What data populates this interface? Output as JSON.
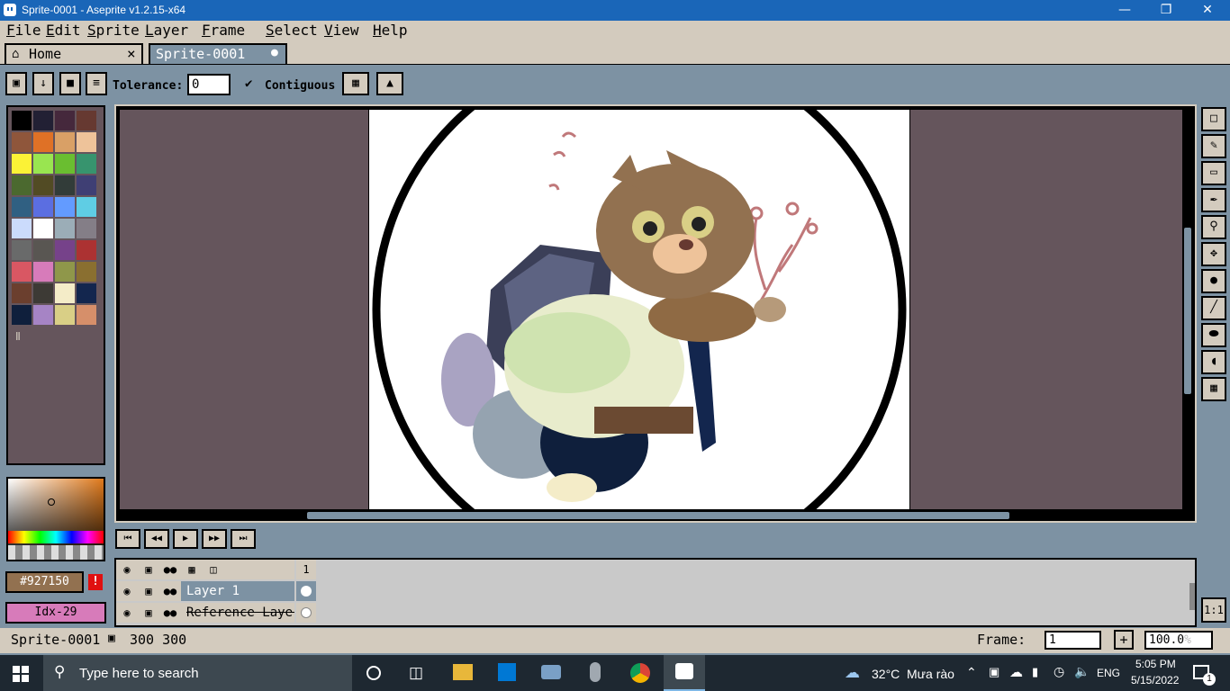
{
  "window": {
    "title": "Sprite-0001 - Aseprite v1.2.15-x64",
    "minimize": "—",
    "restore": "❐",
    "close": "✕"
  },
  "menu": {
    "items": [
      {
        "key": "F",
        "rest": "ile"
      },
      {
        "key": "E",
        "rest": "dit"
      },
      {
        "key": "S",
        "rest": "prite"
      },
      {
        "key": "L",
        "rest": "ayer"
      },
      {
        "key": "F",
        "rest": "rame"
      },
      {
        "key": "S",
        "rest": "elect"
      },
      {
        "key": "V",
        "rest": "iew"
      },
      {
        "key": "H",
        "rest": "elp"
      }
    ]
  },
  "tabs": {
    "home": {
      "label": "Home",
      "close": "×"
    },
    "sprite": {
      "label": "Sprite-0001",
      "dot": "●"
    }
  },
  "context": {
    "tolerance_label": "Tolerance:",
    "tolerance_value": "0",
    "contiguous_label": "Contiguous",
    "contiguous_check": "✔"
  },
  "palette": {
    "colors": [
      "#000000",
      "#222034",
      "#45283c",
      "#663931",
      "#8f563b",
      "#df7126",
      "#d9a066",
      "#eec39a",
      "#fbf236",
      "#99e550",
      "#6abe30",
      "#37946e",
      "#4b692f",
      "#524b24",
      "#323c39",
      "#3f3f74",
      "#306082",
      "#5b6ee1",
      "#639bff",
      "#5fcde4",
      "#cbdbfc",
      "#ffffff",
      "#9badb7",
      "#847e87",
      "#696a6a",
      "#595652",
      "#76428a",
      "#ac3232",
      "#d95763",
      "#d77bba",
      "#8f974a",
      "#8a6f30",
      "#6b3f2e",
      "#3d3a35",
      "#f4ecc8",
      "#13264e",
      "#0f1f3c",
      "#a684c5",
      "#d9cf86",
      "#d68f6a"
    ],
    "more_icon": "Ⅱ",
    "fg_hex": "#927150",
    "bg_index": "Idx-29",
    "warning": "!"
  },
  "sprite": {
    "bg_color": "#65555c",
    "paper_color": "#ffffff"
  },
  "timeline": {
    "frame_number": "1",
    "layers": [
      {
        "name": "Layer 1"
      },
      {
        "name": "Reference Layer"
      }
    ]
  },
  "status": {
    "sprite_name": "Sprite-0001",
    "size": "300 300",
    "frame_label": "Frame:",
    "frame_value": "1",
    "add": "+",
    "zoom": "100.0",
    "zoom_unit": "%"
  },
  "taskbar": {
    "search_placeholder": "Type here to search",
    "weather_temp": "32°C",
    "weather_text": "Mưa rào",
    "lang": "ENG",
    "time": "5:05 PM",
    "date": "5/15/2022",
    "notif_count": "1"
  },
  "tool_scale": "1:1"
}
